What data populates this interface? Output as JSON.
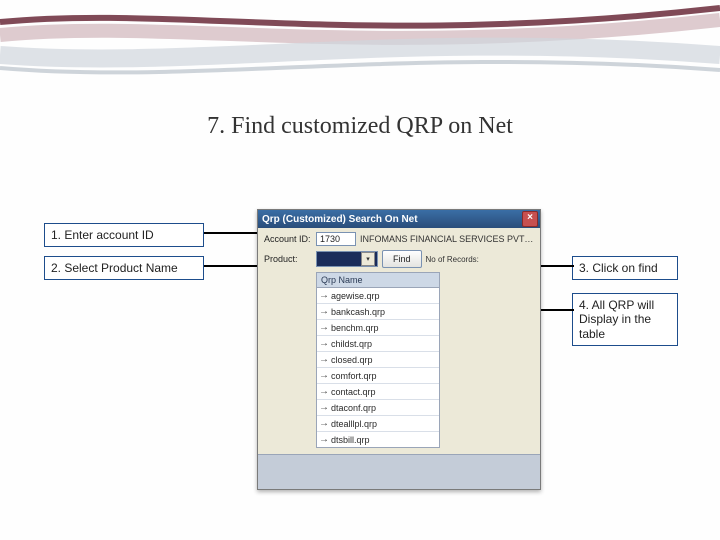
{
  "title": "7. Find customized QRP on Net",
  "callouts": {
    "c1": "1. Enter account ID",
    "c2": "2. Select Product Name",
    "c3": "3. Click on find",
    "c4": "4. All QRP will Display in the table"
  },
  "window": {
    "title": "Qrp (Customized) Search On Net",
    "labels": {
      "account": "Account ID:",
      "product": "Product:",
      "no_records": "No of Records:"
    },
    "account_id": "1730",
    "account_name": "INFOMANS FINANCIAL SERVICES PVT LTD",
    "product_selected": "",
    "find_label": "Find",
    "table_header": "Qrp Name",
    "rows": [
      "agewise.qrp",
      "bankcash.qrp",
      "benchm.qrp",
      "childst.qrp",
      "closed.qrp",
      "comfort.qrp",
      "contact.qrp",
      "dtaconf.qrp",
      "dtealllpl.qrp",
      "dtsbill.qrp"
    ]
  }
}
